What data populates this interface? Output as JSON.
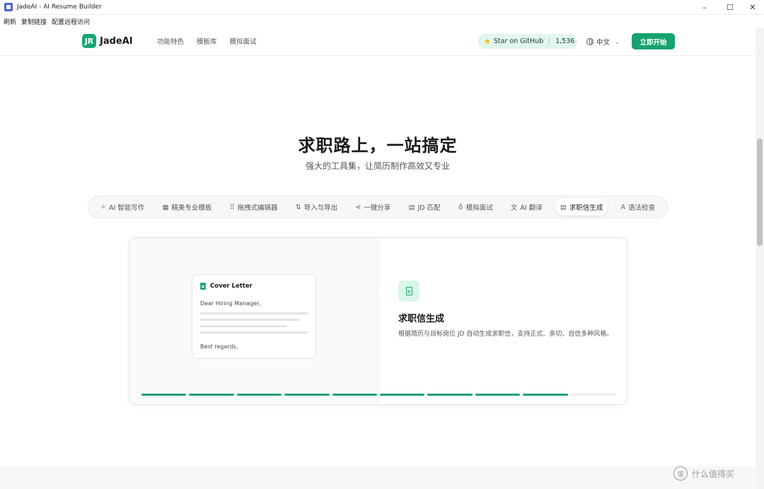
{
  "window": {
    "title": "JadeAI - AI Resume Builder",
    "minimize": "–",
    "maximize": "☐",
    "close": "✕"
  },
  "menubar": [
    "刷新",
    "复制链接",
    "配置远程访问"
  ],
  "nav": {
    "logo_mark": "JR",
    "logo_text": "JadeAI",
    "links": [
      "功能特色",
      "模板库",
      "模拟面试"
    ],
    "github_label": "Star on GitHub",
    "github_count": "1,536",
    "language": "中文",
    "cta": "立即开始"
  },
  "hero": {
    "title": "求职路上，一站搞定",
    "subtitle": "强大的工具集，让简历制作高效又专业"
  },
  "tabs": [
    {
      "icon": "✧",
      "label": "AI 智能写作"
    },
    {
      "icon": "▦",
      "label": "精美专业模板"
    },
    {
      "icon": "⠿",
      "label": "拖拽式编辑器"
    },
    {
      "icon": "⇅",
      "label": "导入与导出"
    },
    {
      "icon": "⋖",
      "label": "一键分享"
    },
    {
      "icon": "▤",
      "label": "JD 匹配"
    },
    {
      "icon": "♁",
      "label": "模拟面试"
    },
    {
      "icon": "文",
      "label": "AI 翻译"
    },
    {
      "icon": "▤",
      "label": "求职信生成"
    },
    {
      "icon": "A",
      "label": "语法检查"
    }
  ],
  "active_tab": 8,
  "feature": {
    "doc_title": "Cover Letter",
    "doc_greeting": "Dear Hiring Manager,",
    "doc_closing": "Best regards,",
    "title": "求职信生成",
    "description": "根据简历与目标岗位 JD 自动生成求职信，支持正式、亲切、自信多种风格。"
  },
  "progress": {
    "total": 10,
    "done": 9
  },
  "watermark": "什么值得买",
  "colors": {
    "accent": "#16a36e",
    "accent_light": "#e1f6ec",
    "star": "#f2b705"
  }
}
